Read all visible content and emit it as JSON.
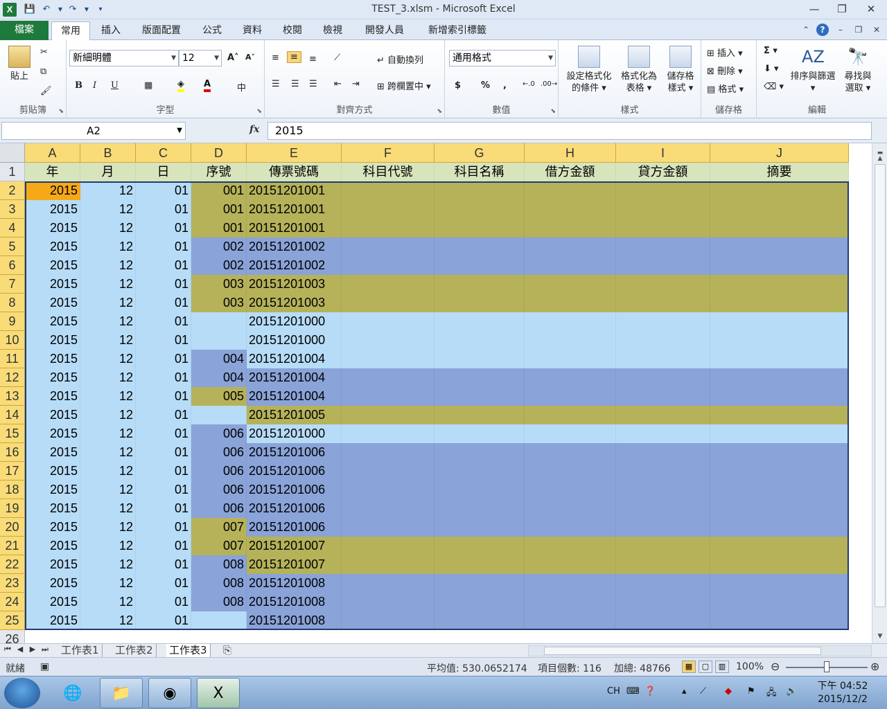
{
  "window": {
    "title": "TEST_3.xlsm - Microsoft Excel",
    "minimize": "—",
    "restore": "❐",
    "close": "✕"
  },
  "ribbon_tabs": {
    "file": "檔案",
    "tabs": [
      "常用",
      "插入",
      "版面配置",
      "公式",
      "資料",
      "校閱",
      "檢視",
      "開發人員",
      "新增索引標籤"
    ]
  },
  "ribbon": {
    "clipboard": {
      "paste": "貼上",
      "label": "剪貼簿"
    },
    "font": {
      "name": "新細明體",
      "size": "12",
      "label": "字型",
      "bold": "B",
      "italic": "I",
      "underline": "U"
    },
    "alignment": {
      "wrap": "自動換列",
      "merge": "跨欄置中",
      "label": "對齊方式"
    },
    "number": {
      "format": "通用格式",
      "label": "數值",
      "currency": "$",
      "percent": "%",
      "comma": ","
    },
    "styles": {
      "conditional": [
        "設定格式化",
        "的條件"
      ],
      "table": [
        "格式化為",
        "表格"
      ],
      "cell": [
        "儲存格",
        "樣式"
      ],
      "label": "樣式"
    },
    "cells": {
      "insert": "插入",
      "delete": "刪除",
      "format": "格式",
      "label": "儲存格"
    },
    "editing": {
      "sort": "排序與篩選",
      "find": [
        "尋找與",
        "選取"
      ],
      "label": "編輯",
      "sigma": "Σ"
    }
  },
  "formula_bar": {
    "name_box": "A2",
    "fx": "fx",
    "content": "2015"
  },
  "columns": [
    "A",
    "B",
    "C",
    "D",
    "E",
    "F",
    "G",
    "H",
    "I",
    "J"
  ],
  "headers": [
    "年",
    "月",
    "日",
    "序號",
    "傳票號碼",
    "科目代號",
    "科目名稱",
    "借方金額",
    "貸方金額",
    "摘要"
  ],
  "rows": [
    {
      "n": "2",
      "y": "2015",
      "m": "12",
      "d": "01",
      "seq": "001",
      "voucher": "20151201001",
      "band": "olive"
    },
    {
      "n": "3",
      "y": "2015",
      "m": "12",
      "d": "01",
      "seq": "001",
      "voucher": "20151201001",
      "band": "olive"
    },
    {
      "n": "4",
      "y": "2015",
      "m": "12",
      "d": "01",
      "seq": "001",
      "voucher": "20151201001",
      "band": "olive"
    },
    {
      "n": "5",
      "y": "2015",
      "m": "12",
      "d": "01",
      "seq": "002",
      "voucher": "20151201002",
      "band": "blue"
    },
    {
      "n": "6",
      "y": "2015",
      "m": "12",
      "d": "01",
      "seq": "002",
      "voucher": "20151201002",
      "band": "blue"
    },
    {
      "n": "7",
      "y": "2015",
      "m": "12",
      "d": "01",
      "seq": "003",
      "voucher": "20151201003",
      "band": "olive"
    },
    {
      "n": "8",
      "y": "2015",
      "m": "12",
      "d": "01",
      "seq": "003",
      "voucher": "20151201003",
      "band": "olive"
    },
    {
      "n": "9",
      "y": "2015",
      "m": "12",
      "d": "01",
      "seq": "",
      "voucher": "20151201000",
      "band": "light"
    },
    {
      "n": "10",
      "y": "2015",
      "m": "12",
      "d": "01",
      "seq": "",
      "voucher": "20151201000",
      "band": "light"
    },
    {
      "n": "11",
      "y": "2015",
      "m": "12",
      "d": "01",
      "seq": "004",
      "voucher": "20151201004",
      "band": "light",
      "seqband": "blue"
    },
    {
      "n": "12",
      "y": "2015",
      "m": "12",
      "d": "01",
      "seq": "004",
      "voucher": "20151201004",
      "band": "blue"
    },
    {
      "n": "13",
      "y": "2015",
      "m": "12",
      "d": "01",
      "seq": "005",
      "voucher": "20151201004",
      "band": "blue",
      "seqband": "olive"
    },
    {
      "n": "14",
      "y": "2015",
      "m": "12",
      "d": "01",
      "seq": "",
      "voucher": "20151201005",
      "band": "olive",
      "seqband": "light"
    },
    {
      "n": "15",
      "y": "2015",
      "m": "12",
      "d": "01",
      "seq": "006",
      "voucher": "20151201000",
      "band": "light",
      "seqband": "blue"
    },
    {
      "n": "16",
      "y": "2015",
      "m": "12",
      "d": "01",
      "seq": "006",
      "voucher": "20151201006",
      "band": "blue"
    },
    {
      "n": "17",
      "y": "2015",
      "m": "12",
      "d": "01",
      "seq": "006",
      "voucher": "20151201006",
      "band": "blue"
    },
    {
      "n": "18",
      "y": "2015",
      "m": "12",
      "d": "01",
      "seq": "006",
      "voucher": "20151201006",
      "band": "blue"
    },
    {
      "n": "19",
      "y": "2015",
      "m": "12",
      "d": "01",
      "seq": "006",
      "voucher": "20151201006",
      "band": "blue"
    },
    {
      "n": "20",
      "y": "2015",
      "m": "12",
      "d": "01",
      "seq": "007",
      "voucher": "20151201006",
      "band": "blue",
      "seqband": "olive"
    },
    {
      "n": "21",
      "y": "2015",
      "m": "12",
      "d": "01",
      "seq": "007",
      "voucher": "20151201007",
      "band": "olive"
    },
    {
      "n": "22",
      "y": "2015",
      "m": "12",
      "d": "01",
      "seq": "008",
      "voucher": "20151201007",
      "band": "olive",
      "seqband": "blue"
    },
    {
      "n": "23",
      "y": "2015",
      "m": "12",
      "d": "01",
      "seq": "008",
      "voucher": "20151201008",
      "band": "blue"
    },
    {
      "n": "24",
      "y": "2015",
      "m": "12",
      "d": "01",
      "seq": "008",
      "voucher": "20151201008",
      "band": "blue"
    },
    {
      "n": "25",
      "y": "2015",
      "m": "12",
      "d": "01",
      "seq": "",
      "voucher": "20151201008",
      "band": "blue",
      "seqband": "light"
    }
  ],
  "extra_row": "26",
  "header_row_num": "1",
  "colors": {
    "olive": "#b5b25a",
    "blue": "#8aa3d8",
    "light": "#b7dcf7",
    "header_row": "#d8e4bc",
    "selected": "#f7a818"
  },
  "sheets": [
    "工作表1",
    "工作表2",
    "工作表3"
  ],
  "active_sheet": 2,
  "status": {
    "ready": "就緒",
    "average": "平均值: 530.0652174",
    "count": "項目個數: 116",
    "sum": "加總: 48766",
    "zoom": "100%"
  },
  "taskbar": {
    "ime": "CH",
    "time": "下午 04:52",
    "date": "2015/12/2"
  }
}
